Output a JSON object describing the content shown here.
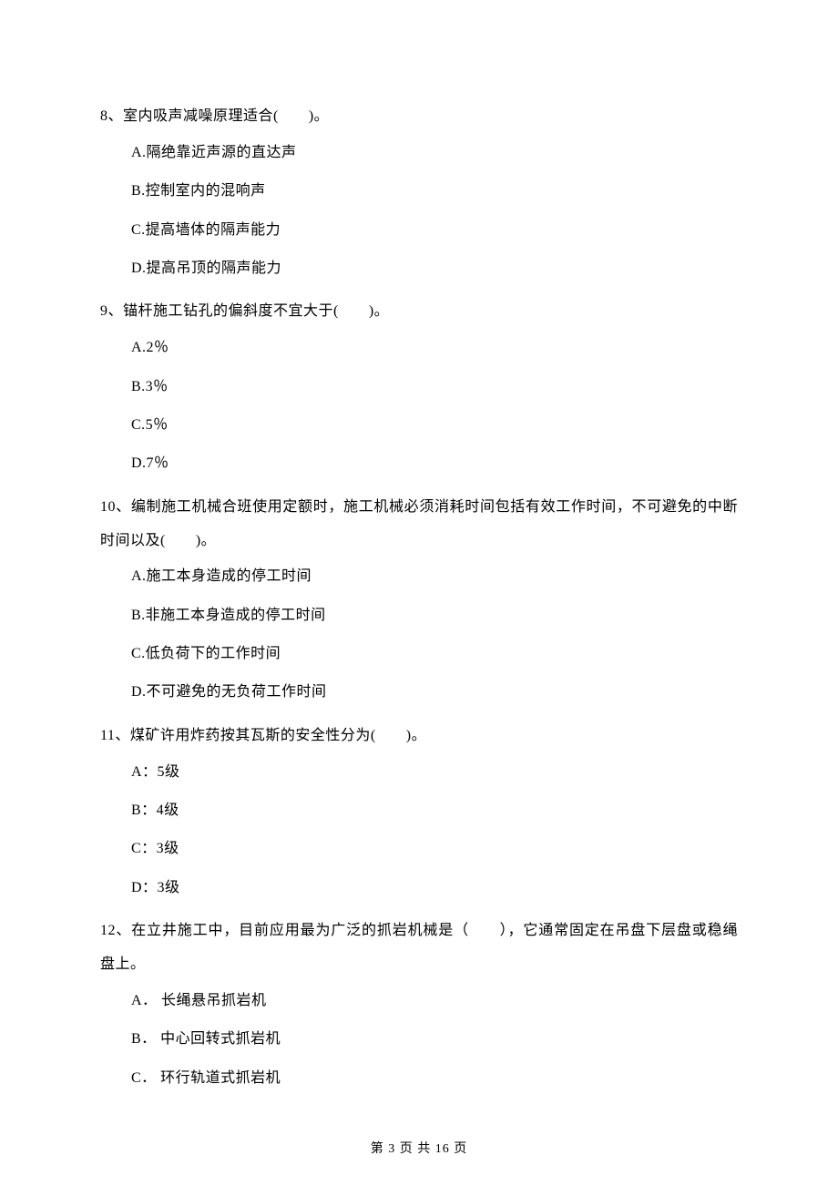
{
  "questions": [
    {
      "stem": "8、室内吸声减噪原理适合(　　)。",
      "options": [
        "A.隔绝靠近声源的直达声",
        "B.控制室内的混响声",
        "C.提高墙体的隔声能力",
        "D.提高吊顶的隔声能力"
      ]
    },
    {
      "stem": "9、锚杆施工钻孔的偏斜度不宜大于(　　)。",
      "options": [
        "A.2％",
        "B.3％",
        "C.5％",
        "D.7％"
      ]
    },
    {
      "stem": "10、编制施工机械合班使用定额时，施工机械必须消耗时间包括有效工作时间，不可避免的中断时间以及(　　)。",
      "options": [
        "A.施工本身造成的停工时间",
        "B.非施工本身造成的停工时间",
        "C.低负荷下的工作时间",
        "D.不可避免的无负荷工作时间"
      ]
    },
    {
      "stem": "11、煤矿许用炸药按其瓦斯的安全性分为(　　)。",
      "options": [
        "A：5级",
        "B：4级",
        "C：3级",
        "D：3级"
      ]
    },
    {
      "stem": "12、在立井施工中，目前应用最为广泛的抓岩机械是（　　），它通常固定在吊盘下层盘或稳绳盘上。",
      "options": [
        "A． 长绳悬吊抓岩机",
        "B． 中心回转式抓岩机",
        "C． 环行轨道式抓岩机"
      ]
    }
  ],
  "footer": "第 3 页 共 16 页"
}
